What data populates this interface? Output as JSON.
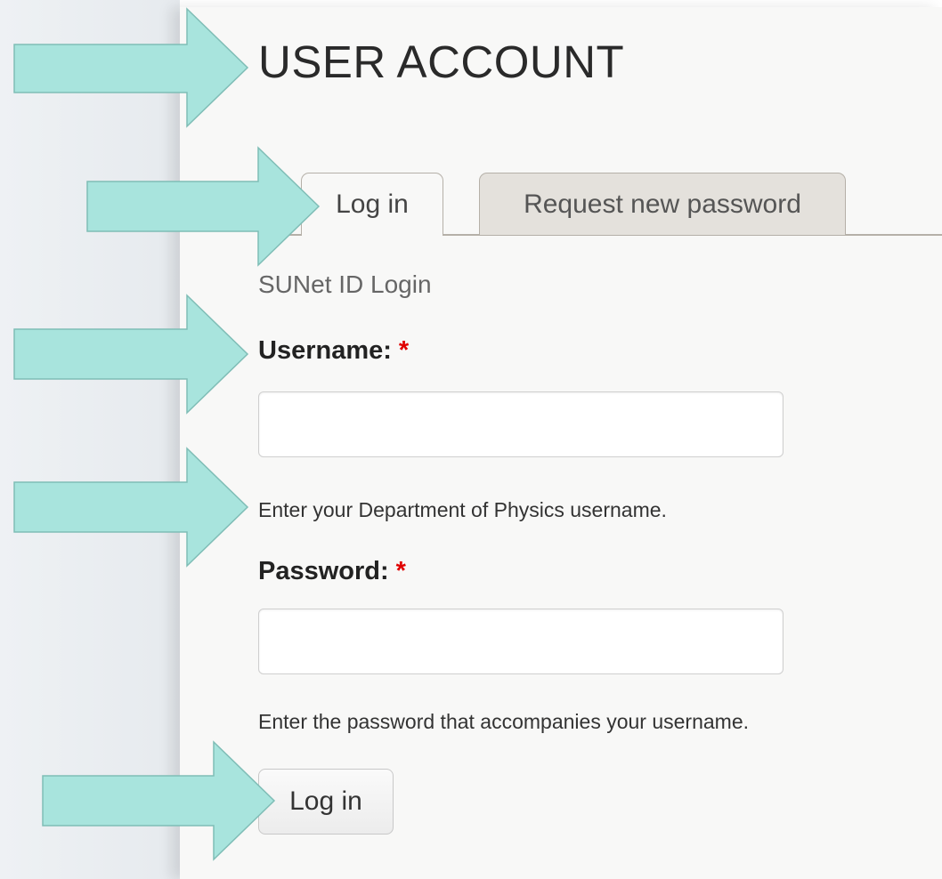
{
  "page": {
    "title": "USER ACCOUNT",
    "tabs": [
      {
        "label": "Log in",
        "active": true
      },
      {
        "label": "Request new password",
        "active": false
      }
    ]
  },
  "login_form": {
    "subtitle": "SUNet ID Login",
    "username": {
      "label": "Username:",
      "required_marker": "*",
      "value": "",
      "help": "Enter your Department of Physics username."
    },
    "password": {
      "label": "Password:",
      "required_marker": "*",
      "value": "",
      "help": "Enter the password that accompanies your username."
    },
    "submit_label": "Log in"
  },
  "annotations": {
    "arrow_color": "#a8e4dd",
    "arrow_count": 5
  },
  "colors": {
    "required": "#e00000",
    "content_background": "#f8f8f7",
    "inactive_tab": "#e4e1dc"
  }
}
